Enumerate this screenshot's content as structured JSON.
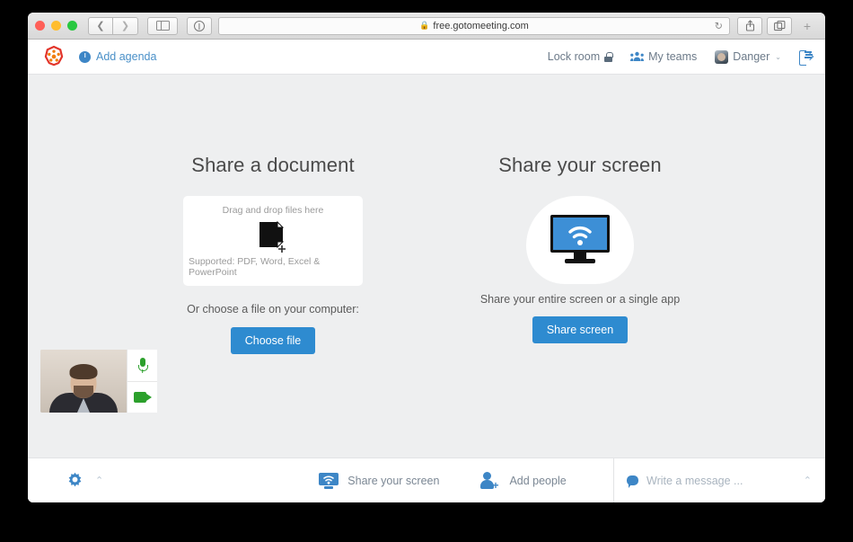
{
  "browser": {
    "url": "free.gotomeeting.com",
    "lock_icon": "lock-icon",
    "reload_icon": "reload-icon",
    "back_icon": "chevron-left-icon",
    "forward_icon": "chevron-right-icon",
    "sidebar_icon": "sidebar-toggle-icon",
    "info_icon": "info-icon",
    "share_icon": "share-icon",
    "tabs_icon": "tabs-overview-icon",
    "new_tab_label": "+"
  },
  "app_header": {
    "logo_name": "gotomeeting-logo",
    "add_agenda_label": "Add agenda",
    "add_agenda_icon": "info-circle-icon",
    "lock_room_label": "Lock room",
    "lock_room_icon": "lock-icon",
    "my_teams_label": "My teams",
    "my_teams_icon": "people-icon",
    "user_name": "Danger",
    "user_avatar": "user-avatar",
    "user_chevron": "⌄",
    "logout_icon": "logout-icon"
  },
  "document_panel": {
    "title": "Share a document",
    "dropzone_top": "Drag and drop files here",
    "dropzone_bottom": "Supported: PDF, Word, Excel & PowerPoint",
    "dropzone_icon": "document-add-icon",
    "or_choose": "Or choose a file on your computer:",
    "choose_file_label": "Choose file"
  },
  "screen_panel": {
    "title": "Share your screen",
    "icon": "monitor-wifi-icon",
    "subtitle": "Share your entire screen or a single app",
    "share_screen_label": "Share screen"
  },
  "video": {
    "thumbnail_name": "self-video-thumbnail",
    "mic_icon": "microphone-icon",
    "camera_icon": "camera-icon"
  },
  "bottom_bar": {
    "settings_icon": "gear-icon",
    "settings_chevron": "⌃",
    "share_screen_label": "Share your screen",
    "share_screen_icon": "monitor-wifi-icon",
    "add_people_label": "Add people",
    "add_people_icon": "person-add-icon",
    "chat_icon": "chat-bubble-icon",
    "chat_placeholder": "Write a message ...",
    "chat_value": "",
    "chat_chevron": "⌃"
  },
  "colors": {
    "accent_blue": "#2e8bd0",
    "link_blue": "#3d86c6",
    "logo_orange": "#f07d0a",
    "logo_red": "#e2342a",
    "green": "#2ca02c",
    "page_bg": "#eeeff0",
    "panel_white": "#ffffff",
    "muted_text": "#7b8794"
  }
}
